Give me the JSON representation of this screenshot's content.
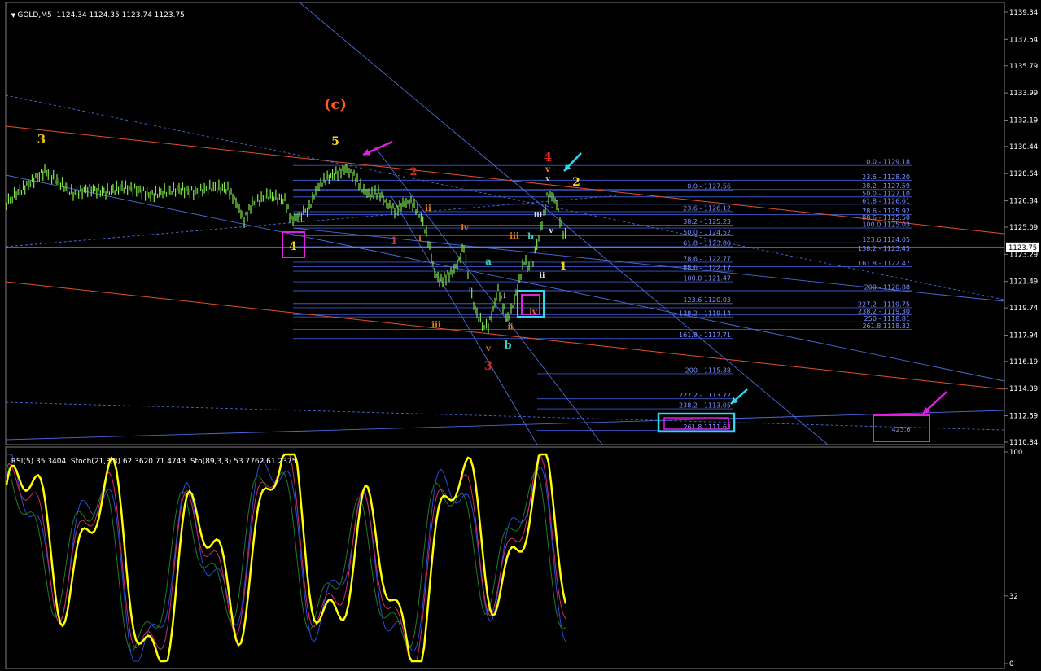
{
  "header": {
    "symbol": "GOLD,M5",
    "ohlc": "1124.34 1124.35 1123.74 1123.75",
    "indicator_title": "RSI(5) 35.3404  Stoch(21,3,3) 62.3620 71.4743  Sto(89,3,3) 53.7762 61.2375"
  },
  "colors": {
    "background": "#000000",
    "candles": "#7fe84a",
    "fib_lines": "#3b57c9",
    "channel_blue": "#4a6ad8",
    "channel_red": "#e0502a",
    "magenta": "#e020e0",
    "cyan": "#30d8ee",
    "rsi": "#ffff00",
    "current_price_tag": "#ffffff"
  },
  "chart_data": {
    "type": "line",
    "price_axis": {
      "ticks": [
        "1139.34",
        "1137.54",
        "1135.79",
        "1133.99",
        "1132.19",
        "1130.44",
        "1128.64",
        "1126.84",
        "1125.09",
        "1123.29",
        "1121.49",
        "1119.74",
        "1117.94",
        "1116.19",
        "1114.39",
        "1112.59",
        "1110.84"
      ],
      "current_price": "1123.75",
      "ylim": [
        1110.84,
        1139.34
      ]
    },
    "indicator_axis": {
      "ticks": [
        "100",
        "32",
        "0"
      ],
      "ylim": [
        0,
        100
      ]
    },
    "fib_levels": [
      {
        "text": "0.0 - 1129.18",
        "price": 1129.18
      },
      {
        "text": "23.6 - 1128.20",
        "price": 1128.2
      },
      {
        "text": "38.2 - 1127.59",
        "price": 1127.59
      },
      {
        "text": "50.0 - 1127.10",
        "price": 1127.1
      },
      {
        "text": "61.8 - 1126.61",
        "price": 1126.61
      },
      {
        "text": "78.6 - 1125.92",
        "price": 1125.92
      },
      {
        "text": "88.6 - 1125.50",
        "price": 1125.5
      },
      {
        "text": "100.0 1125.03",
        "price": 1125.03
      },
      {
        "text": "123.6 1124.05",
        "price": 1124.05
      },
      {
        "text": "138.2 - 1123.45",
        "price": 1123.45
      },
      {
        "text": "161.8 - 1122.47",
        "price": 1122.47
      },
      {
        "text": "200 - 1120.88",
        "price": 1120.88
      },
      {
        "text": "227.2 - 1119.75",
        "price": 1119.75
      },
      {
        "text": "238.2 - 1119.30",
        "price": 1119.3
      },
      {
        "text": "250 - 1118.81",
        "price": 1118.81
      },
      {
        "text": "261.8 1118.32",
        "price": 1118.32
      },
      {
        "text": "0.0 - 1127.56",
        "price": 1127.56
      },
      {
        "text": "23.6 - 1126.12",
        "price": 1126.12
      },
      {
        "text": "38.2 - 1125.23",
        "price": 1125.23
      },
      {
        "text": "50.0 - 1124.52",
        "price": 1124.52
      },
      {
        "text": "61.8 - 1123.80",
        "price": 1123.8
      },
      {
        "text": "78.6 - 1122.77",
        "price": 1122.77
      },
      {
        "text": "88.6 - 1122.17",
        "price": 1122.17
      },
      {
        "text": "100.0 1121.47",
        "price": 1121.47
      },
      {
        "text": "123.6 1120.03",
        "price": 1120.03
      },
      {
        "text": "138.2 - 1119.14",
        "price": 1119.14
      },
      {
        "text": "161.8 - 1117.71",
        "price": 1117.71
      },
      {
        "text": "200 - 1115.38",
        "price": 1115.38
      },
      {
        "text": "227.2 - 1113.72",
        "price": 1113.72
      },
      {
        "text": "238.2 - 1113.05",
        "price": 1113.05
      },
      {
        "text": "261.8 1111.62",
        "price": 1111.62
      },
      {
        "text": "423.6",
        "price": 1111.7
      }
    ],
    "wave_labels": [
      {
        "text": "3",
        "color": "#e8c21a"
      },
      {
        "text": "(c)",
        "color": "#ff5a1a"
      },
      {
        "text": "5",
        "color": "#ffd21a"
      },
      {
        "text": "4",
        "color": "#ffd21a"
      },
      {
        "text": "2",
        "color": "#d6301a"
      },
      {
        "text": "1",
        "color": "#d6301a"
      },
      {
        "text": "ii",
        "color": "#e07a1a"
      },
      {
        "text": "i",
        "color": "#e07a1a"
      },
      {
        "text": "iv",
        "color": "#e07a1a"
      },
      {
        "text": "iii",
        "color": "#e07a1a"
      },
      {
        "text": "a",
        "color": "#3ad0c0"
      },
      {
        "text": "iii",
        "color": "#e07a1a"
      },
      {
        "text": "b",
        "color": "#3ad0c0"
      },
      {
        "text": "v",
        "color": "#e07a1a"
      },
      {
        "text": "3",
        "color": "#e0201a"
      },
      {
        "text": "b",
        "color": "#3ad0c0"
      },
      {
        "text": "ii",
        "color": "#e07a1a"
      },
      {
        "text": "iv",
        "color": "#e07a1a"
      },
      {
        "text": "4",
        "color": "#e0201a"
      },
      {
        "text": "v",
        "color": "#e07a1a"
      },
      {
        "text": "v",
        "color": "#c0c0c0"
      },
      {
        "text": "2",
        "color": "#ffd21a"
      },
      {
        "text": "iii",
        "color": "#e0e0e0"
      },
      {
        "text": "v",
        "color": "#e0e0e0"
      },
      {
        "text": "ii",
        "color": "#e0e0e0"
      },
      {
        "text": "1",
        "color": "#ffd21a"
      },
      {
        "text": "i",
        "color": "#e0e0e0"
      }
    ]
  }
}
